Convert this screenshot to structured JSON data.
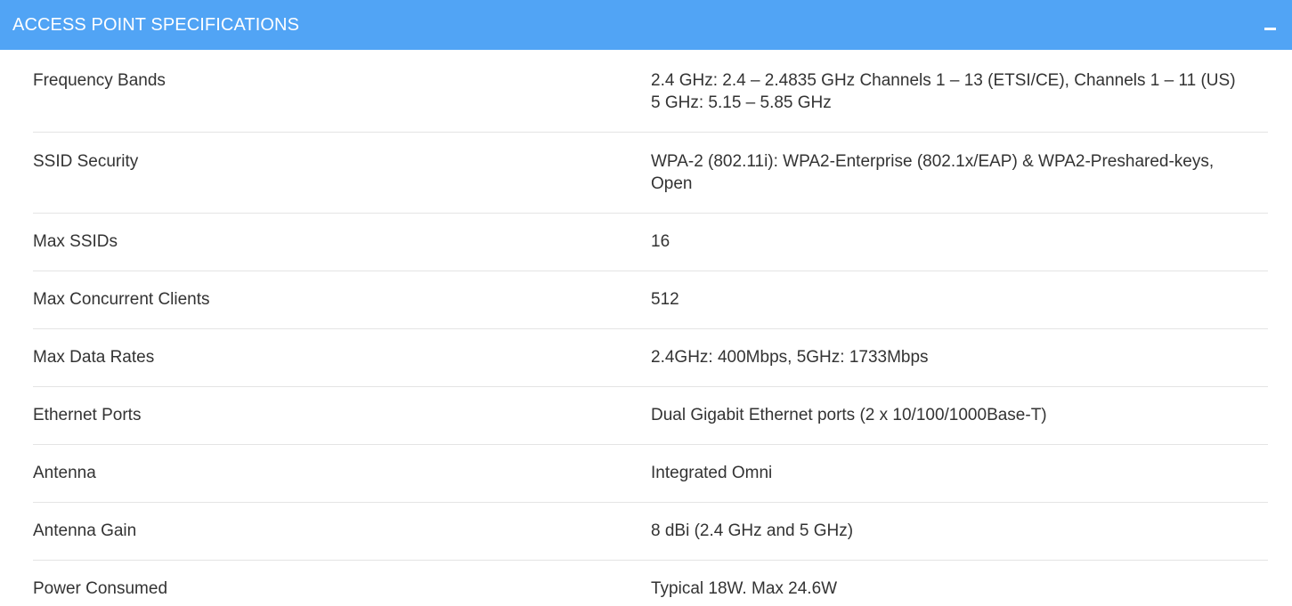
{
  "panel": {
    "title": "ACCESS POINT SPECIFICATIONS",
    "collapse_icon": "minus-icon",
    "header_color": "#51a4f5"
  },
  "specs": [
    {
      "label": "Frequency Bands",
      "value_lines": [
        "2.4 GHz: 2.4 – 2.4835 GHz Channels 1 – 13 (ETSI/CE), Channels 1 – 11 (US)",
        "5 GHz: 5.15 – 5.85 GHz"
      ]
    },
    {
      "label": "SSID Security",
      "value_lines": [
        "WPA-2 (802.11i): WPA2-Enterprise (802.1x/EAP) & WPA2-Preshared-keys,",
        "Open"
      ]
    },
    {
      "label": "Max SSIDs",
      "value_lines": [
        "16"
      ]
    },
    {
      "label": "Max Concurrent Clients",
      "value_lines": [
        "512"
      ]
    },
    {
      "label": "Max Data Rates",
      "value_lines": [
        "2.4GHz: 400Mbps, 5GHz: 1733Mbps"
      ]
    },
    {
      "label": "Ethernet Ports",
      "value_lines": [
        "Dual Gigabit Ethernet ports (2 x 10/100/1000Base-T)"
      ]
    },
    {
      "label": "Antenna",
      "value_lines": [
        "Integrated Omni"
      ]
    },
    {
      "label": "Antenna Gain",
      "value_lines": [
        "8 dBi (2.4 GHz and 5 GHz)"
      ]
    },
    {
      "label": "Power Consumed",
      "value_lines": [
        "Typical 18W. Max 24.6W"
      ]
    }
  ]
}
